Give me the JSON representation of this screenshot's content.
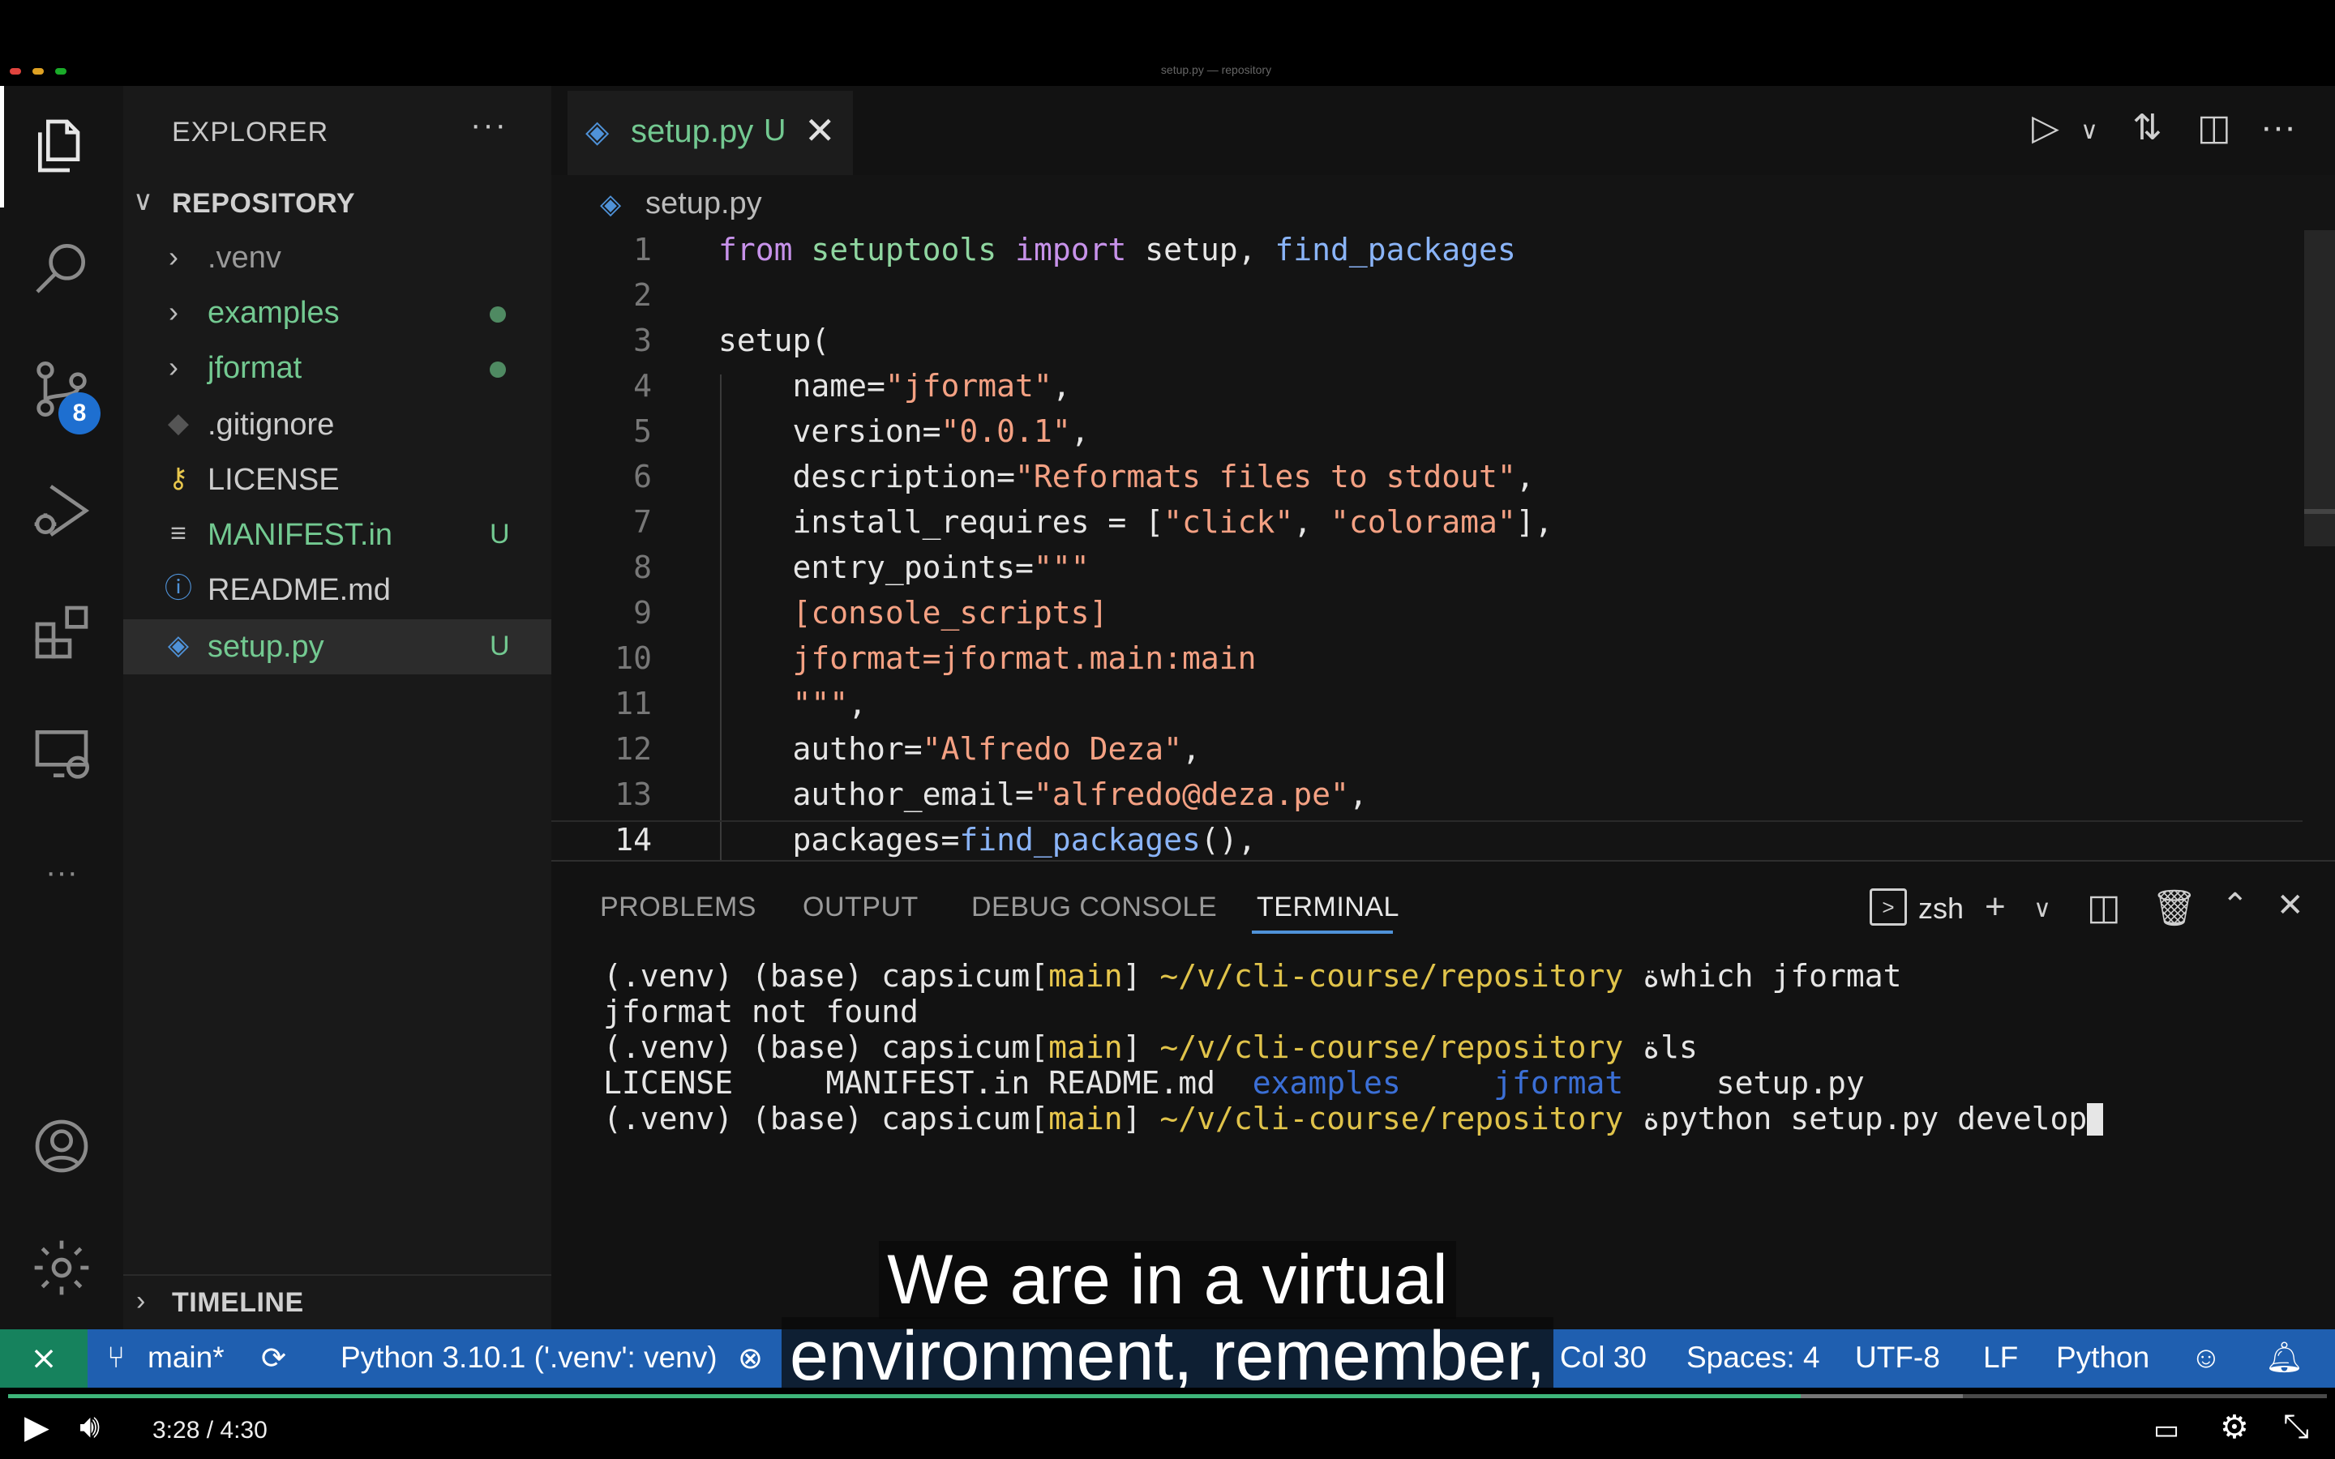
{
  "window": {
    "title": "setup.py — repository"
  },
  "activity_bar": {
    "scm_badge": "8"
  },
  "sidebar": {
    "title": "EXPLORER",
    "more": "···",
    "section": "REPOSITORY",
    "items": [
      {
        "label": ".venv",
        "color": "#9a9a9a",
        "kind": "folder"
      },
      {
        "label": "examples",
        "color": "#73c991",
        "kind": "folder"
      },
      {
        "label": "jformat",
        "color": "#73c991",
        "kind": "folder"
      },
      {
        "label": ".gitignore",
        "color": "#cccccc",
        "kind": "git-icon"
      },
      {
        "label": "LICENSE",
        "color": "#cccccc",
        "kind": "license-icon"
      },
      {
        "label": "MANIFEST.in",
        "color": "#73c991",
        "status": "U",
        "kind": "lines-icon"
      },
      {
        "label": "README.md",
        "color": "#cccccc",
        "kind": "info-icon"
      },
      {
        "label": "setup.py",
        "color": "#73c991",
        "status": "U",
        "kind": "python-icon"
      }
    ],
    "timeline": "TIMELINE"
  },
  "editor": {
    "tab": {
      "label": "setup.py",
      "status": "U"
    },
    "breadcrumb": "setup.py",
    "lines": [
      {
        "n": "1",
        "text": "from setuptools import setup, find_packages"
      },
      {
        "n": "2",
        "text": ""
      },
      {
        "n": "3",
        "text": "setup("
      },
      {
        "n": "4",
        "text": "    name=\"jformat\","
      },
      {
        "n": "5",
        "text": "    version=\"0.0.1\","
      },
      {
        "n": "6",
        "text": "    description=\"Reformats files to stdout\","
      },
      {
        "n": "7",
        "text": "    install_requires = [\"click\", \"colorama\"],"
      },
      {
        "n": "8",
        "text": "    entry_points=\"\"\""
      },
      {
        "n": "9",
        "text": "    [console_scripts]"
      },
      {
        "n": "10",
        "text": "    jformat=jformat.main:main"
      },
      {
        "n": "11",
        "text": "    \"\"\","
      },
      {
        "n": "12",
        "text": "    author=\"Alfredo Deza\","
      },
      {
        "n": "13",
        "text": "    author_email=\"alfredo@deza.pe\","
      },
      {
        "n": "14",
        "text": "    packages=find_packages(),"
      }
    ]
  },
  "panel": {
    "tabs": [
      "PROBLEMS",
      "OUTPUT",
      "DEBUG CONSOLE",
      "TERMINAL"
    ],
    "active_tab": "TERMINAL",
    "shell": "zsh",
    "terminal": {
      "prompt_prefix": "(.venv) (base) capsicum[",
      "branch": "main",
      "prompt_mid": "] ",
      "path": "~/v/cli-course/repository",
      "prompt_symbol": " ة",
      "line1_cmd": "which jformat",
      "line2": "jformat not found",
      "line3_cmd": "ls",
      "ls_plain1": "LICENSE     MANIFEST.in README.md  ",
      "ls_dir1": "examples",
      "ls_gap": "     ",
      "ls_dir2": "jformat",
      "ls_plain2": "     setup.py",
      "line5_cmd": "python setup.py develop"
    }
  },
  "status_bar": {
    "remote": "⨯",
    "branch": "main*",
    "interpreter": "Python 3.10.1 ('.venv': venv)",
    "col": "Col 30",
    "spaces": "Spaces: 4",
    "encoding": "UTF-8",
    "eol": "LF",
    "language": "Python"
  },
  "caption": {
    "line1": "We are in a virtual",
    "line2": "environment, remember,"
  },
  "video": {
    "time": "3:28  /  4:30",
    "progress": 0.773
  }
}
